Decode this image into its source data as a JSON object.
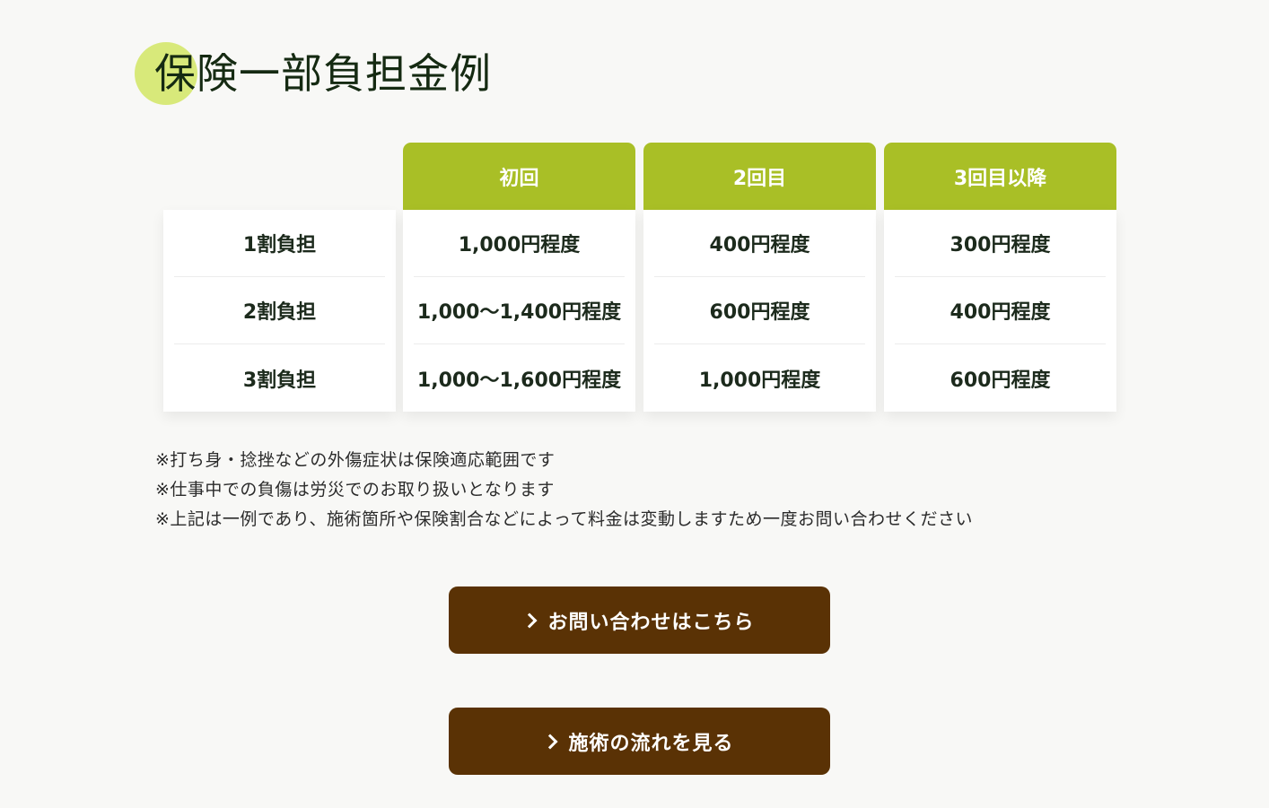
{
  "section": {
    "title": "保険一部負担金例"
  },
  "table": {
    "headers": [
      "初回",
      "2回目",
      "3回目以降"
    ],
    "row_labels": [
      "1割負担",
      "2割負担",
      "3割負担"
    ],
    "columns": [
      [
        "1,000円程度",
        "1,000〜1,400円程度",
        "1,000〜1,600円程度"
      ],
      [
        "400円程度",
        "600円程度",
        "1,000円程度"
      ],
      [
        "300円程度",
        "400円程度",
        "600円程度"
      ]
    ]
  },
  "notes": [
    "※打ち身・捻挫などの外傷症状は保険適応範囲です",
    "※仕事中での負傷は労災でのお取り扱いとなります",
    "※上記は一例であり、施術箇所や保険割合などによって料金は変動しますため一度お問い合わせください"
  ],
  "buttons": {
    "contact_label": "お問い合わせはこちら",
    "flow_label": "施術の流れを見る"
  },
  "colors": {
    "header_green": "#a9bf26",
    "accent_circle": "#d8e97a",
    "button_brown": "#5a3205"
  },
  "icons": {
    "button_icon": "chevron-right-icon"
  }
}
